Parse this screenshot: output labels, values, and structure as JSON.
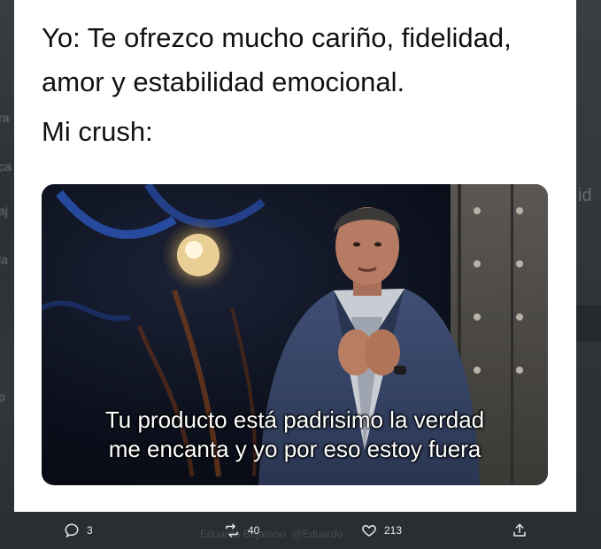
{
  "post": {
    "caption_line1": "Yo: Te ofrezco mucho cariño, fidelidad,",
    "caption_line2": "amor y estabilidad emocional.",
    "caption_line3": "Mi crush:",
    "image": {
      "subtitle_line1": "Tu producto está padrisimo la verdad",
      "subtitle_line2": "me encanta y yo por eso estoy fuera"
    }
  },
  "actions": {
    "reply_icon": "reply-bubble-icon",
    "reply_count": "3",
    "retweet_icon": "retweet-arrows-icon",
    "retweet_count": "40",
    "like_icon": "heart-icon",
    "like_count": "213",
    "share_icon": "share-upload-icon"
  },
  "background": {
    "blurred_name": "Eduardo Bejarano",
    "blurred_handle": "@Eduardo"
  },
  "colors": {
    "card": "#ffffff",
    "page_bg": "#2f3336",
    "action_bar": "#2a2e32",
    "action_text": "#e7e9ea"
  }
}
